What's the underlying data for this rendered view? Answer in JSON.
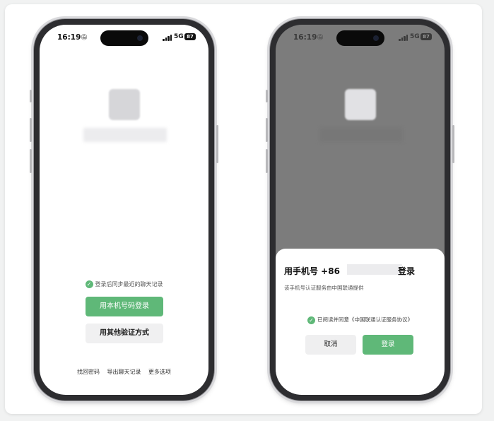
{
  "status": {
    "time": "16:19",
    "network": "5G",
    "battery": "87",
    "icons": [
      "bell-slash-icon",
      "signal-icon"
    ]
  },
  "left_screen": {
    "sync_label": "登录后同步最近的聊天记录",
    "primary_button": "用本机号码登录",
    "secondary_button": "用其他验证方式",
    "links": [
      "找回密码",
      "导出聊天记录",
      "更多选项"
    ]
  },
  "right_screen": {
    "sheet_title_prefix": "用手机号 +86",
    "sheet_title_suffix": "登录",
    "sheet_subtitle": "该手机号认证服务由中国联通提供",
    "agreement": "已阅读并同意《中国联通认证服务协议》",
    "cancel_button": "取消",
    "login_button": "登录"
  },
  "colors": {
    "accent_green": "#5fb878",
    "dim_overlay": "#7c7c7c"
  }
}
